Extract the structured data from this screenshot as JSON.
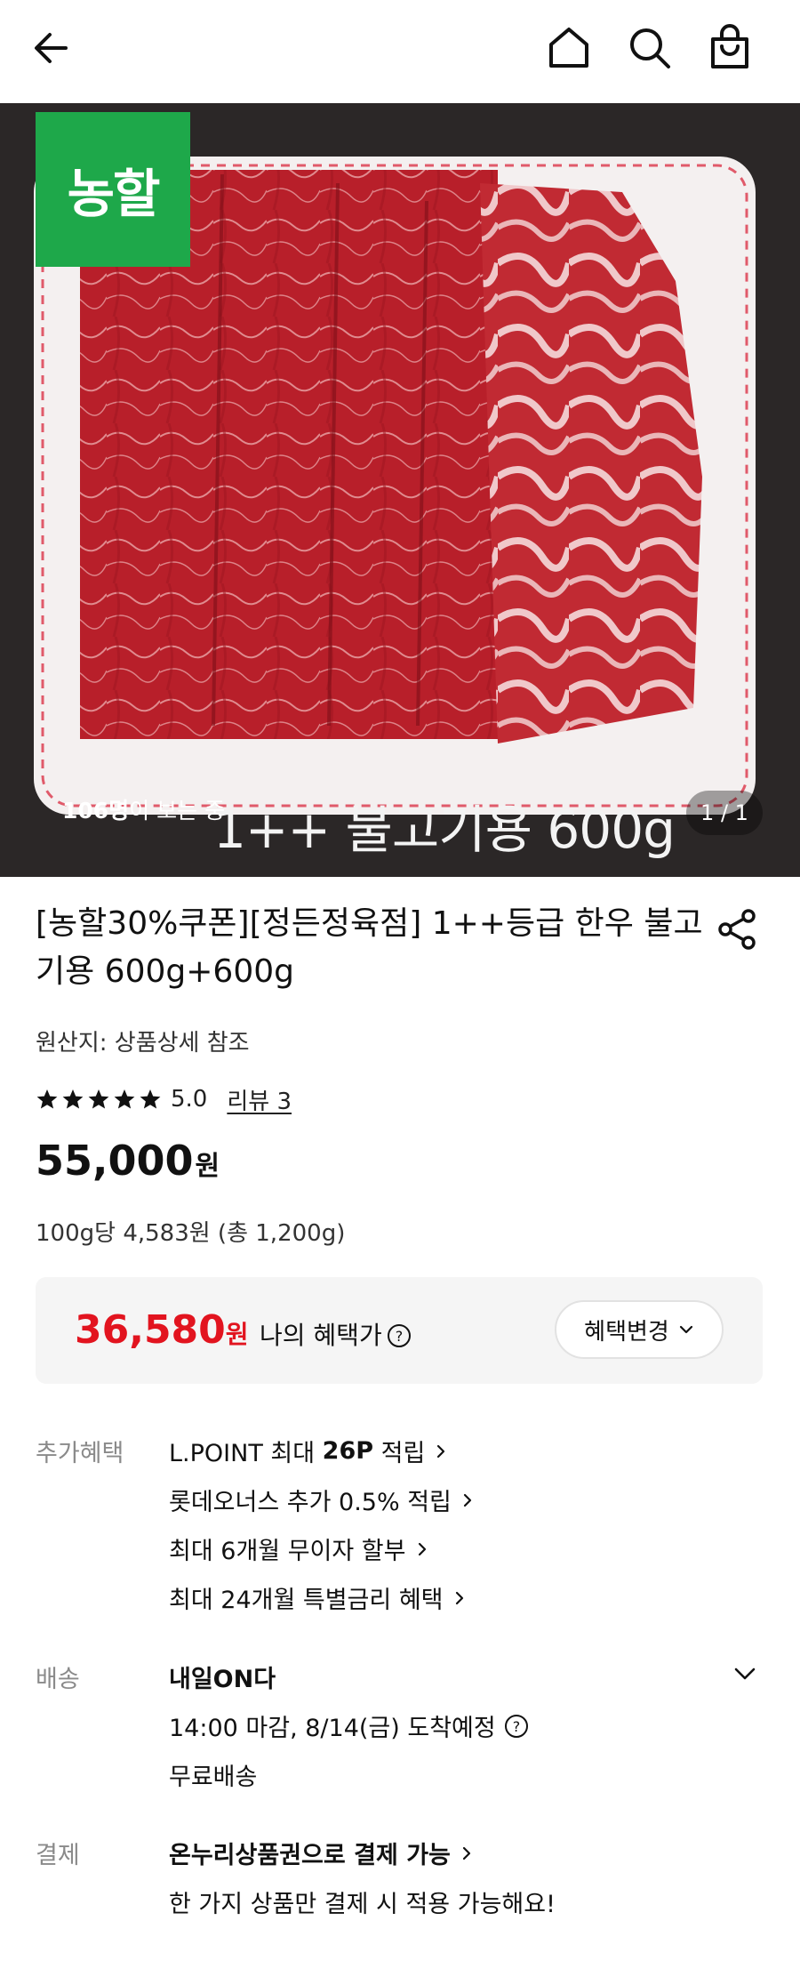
{
  "header": {
    "back_icon": "back-arrow-icon",
    "home_icon": "home-icon",
    "search_icon": "search-icon",
    "cart_icon": "shopping-bag-icon"
  },
  "hero": {
    "logo_text": "농할",
    "caption": "1++ 불고기용 600g",
    "viewers_count": "106명",
    "viewers_suffix": "이 보는 중",
    "pager": "1 / 1"
  },
  "product": {
    "title": "[농할30%쿠폰][정든정육점] 1++등급 한우 불고기용 600g+600g",
    "origin": "원산지: 상품상세 참조",
    "rating": {
      "stars": 5,
      "score": "5.0",
      "review_link": "리뷰 3"
    },
    "price": "55,000",
    "price_unit": "원",
    "unit_price": "100g당 4,583원 (총 1,200g)"
  },
  "benefit": {
    "price": "36,580",
    "price_unit": "원",
    "label": "나의 혜택가",
    "change_button": "혜택변경"
  },
  "extra_benefits": {
    "label": "추가혜택",
    "items": [
      {
        "prefix": "L.POINT 최대 ",
        "bold": "26P",
        "suffix": " 적립"
      },
      {
        "text": "롯데오너스 추가 0.5% 적립"
      },
      {
        "text": "최대 6개월 무이자 할부"
      },
      {
        "text": "최대 24개월 특별금리 혜택"
      }
    ]
  },
  "delivery": {
    "label": "배송",
    "title": "내일ON다",
    "eta": "14:00 마감, 8/14(금) 도착예정",
    "fee": "무료배송"
  },
  "payment": {
    "label": "결제",
    "title": "온누리상품권으로 결제 가능",
    "note": "한 가지 상품만 결제 시 적용 가능해요!"
  },
  "colors": {
    "accent_red": "#e2141f",
    "nonghal_green": "#1ea84a"
  }
}
